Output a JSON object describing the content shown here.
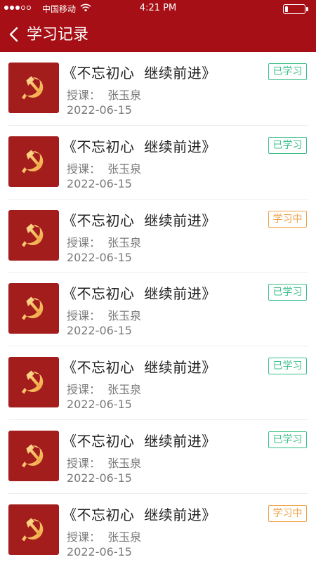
{
  "status_bar": {
    "carrier": "中国移动",
    "time": "4:21 PM",
    "battery_level": 0.15,
    "signal_bars": 3
  },
  "nav": {
    "title": "学习记录"
  },
  "colors": {
    "brand_red": "#a50f15",
    "badge_done": "#3cc08a",
    "badge_in_progress": "#f0a247"
  },
  "records": [
    {
      "title": "《不忘初心  继续前进》",
      "teacher": "授课：  张玉泉",
      "date": "2022-06-15",
      "status": "已学习",
      "state": "done"
    },
    {
      "title": "《不忘初心  继续前进》",
      "teacher": "授课：  张玉泉",
      "date": "2022-06-15",
      "status": "已学习",
      "state": "done"
    },
    {
      "title": "《不忘初心  继续前进》",
      "teacher": "授课：  张玉泉",
      "date": "2022-06-15",
      "status": "学习中",
      "state": "progress"
    },
    {
      "title": "《不忘初心  继续前进》",
      "teacher": "授课：  张玉泉",
      "date": "2022-06-15",
      "status": "已学习",
      "state": "done"
    },
    {
      "title": "《不忘初心  继续前进》",
      "teacher": "授课：  张玉泉",
      "date": "2022-06-15",
      "status": "已学习",
      "state": "done"
    },
    {
      "title": "《不忘初心  继续前进》",
      "teacher": "授课：  张玉泉",
      "date": "2022-06-15",
      "status": "已学习",
      "state": "done"
    },
    {
      "title": "《不忘初心  继续前进》",
      "teacher": "授课：  张玉泉",
      "date": "2022-06-15",
      "status": "学习中",
      "state": "progress"
    }
  ]
}
